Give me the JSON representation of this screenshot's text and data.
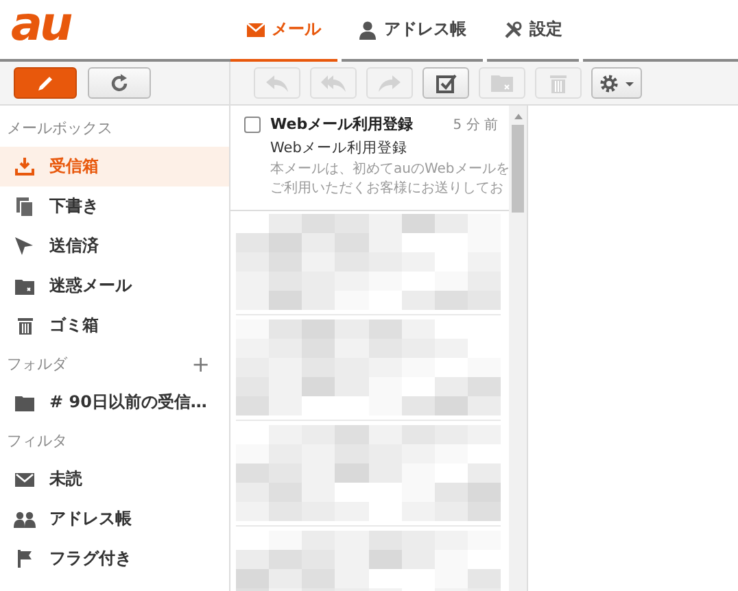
{
  "logo": "au",
  "nav_tabs": [
    {
      "label": "メール",
      "kind": "mail",
      "selected": true
    },
    {
      "label": "アドレス帳",
      "kind": "contacts",
      "selected": false
    },
    {
      "label": "設定",
      "kind": "settings",
      "selected": false
    }
  ],
  "toolbar_left": [
    {
      "kind": "compose"
    },
    {
      "kind": "refresh"
    }
  ],
  "toolbar_actions": [
    {
      "kind": "reply",
      "disabled": true
    },
    {
      "kind": "reply-all",
      "disabled": true
    },
    {
      "kind": "forward",
      "disabled": true
    },
    {
      "kind": "mark",
      "disabled": false
    },
    {
      "kind": "move",
      "disabled": true
    },
    {
      "kind": "delete",
      "disabled": true
    },
    {
      "kind": "settings",
      "disabled": false
    }
  ],
  "sidebar": [
    {
      "heading": "メールボックス",
      "items": [
        {
          "label": "受信箱",
          "kind": "inbox",
          "selected": true
        },
        {
          "label": "下書き",
          "kind": "drafts",
          "selected": false
        },
        {
          "label": "送信済",
          "kind": "sent",
          "selected": false
        },
        {
          "label": "迷惑メール",
          "kind": "spam",
          "selected": false
        },
        {
          "label": "ゴミ箱",
          "kind": "trash",
          "selected": false
        }
      ]
    },
    {
      "heading": "フォルダ",
      "add_button": "+",
      "items": [
        {
          "label": "# 90日以前の受信…",
          "kind": "folder",
          "selected": false
        }
      ]
    },
    {
      "heading": "フィルタ",
      "items": [
        {
          "label": "未読",
          "kind": "unread",
          "selected": false
        },
        {
          "label": "アドレス帳",
          "kind": "contacts",
          "selected": false
        },
        {
          "label": "フラグ付き",
          "kind": "flag",
          "selected": false
        }
      ]
    }
  ],
  "messages": [
    {
      "subject": "Webメール利用登録",
      "time": "5 分 前",
      "sender": "Webメール利用登録",
      "preview": "本メールは、初めてauのWebメールをご利用いただくお客様にお送りしてお",
      "checked": false
    }
  ]
}
